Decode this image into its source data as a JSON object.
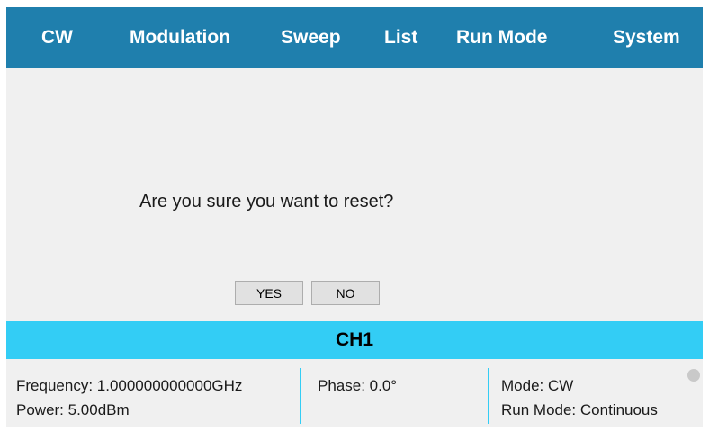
{
  "nav": {
    "items": [
      {
        "label": "CW"
      },
      {
        "label": "Modulation"
      },
      {
        "label": "Sweep"
      },
      {
        "label": "List"
      },
      {
        "label": "Run Mode"
      },
      {
        "label": "System"
      }
    ]
  },
  "dialog": {
    "message": "Are you sure you want to reset?",
    "yes_label": "YES",
    "no_label": "NO"
  },
  "channel": {
    "title": "CH1"
  },
  "status": {
    "frequency": "Frequency: 1.000000000000GHz",
    "power": "Power: 5.00dBm",
    "phase": "Phase: 0.0°",
    "mode": "Mode: CW",
    "run_mode": "Run Mode: Continuous"
  },
  "colors": {
    "nav_bg": "#1f7fad",
    "channel_bar": "#33cdf5",
    "content_bg": "#f0f0f0",
    "indicator": "#c9c9c9"
  }
}
